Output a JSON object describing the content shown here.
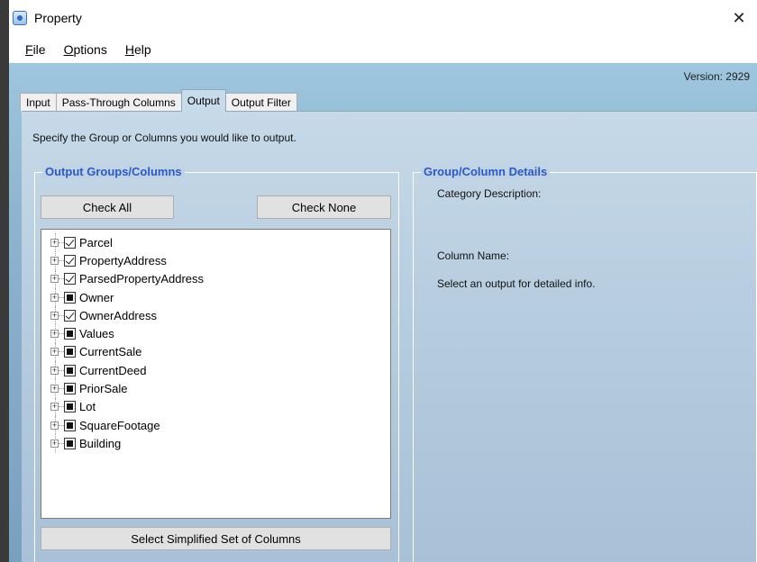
{
  "window": {
    "title": "Property",
    "close_glyph": "✕"
  },
  "menu": [
    {
      "label": "File",
      "accel": "F",
      "rest": "ile"
    },
    {
      "label": "Options",
      "accel": "O",
      "rest": "ptions"
    },
    {
      "label": "Help",
      "accel": "H",
      "rest": "elp"
    }
  ],
  "version": "Version: 2929",
  "tabs": [
    "Input",
    "Pass-Through Columns",
    "Output",
    "Output Filter"
  ],
  "active_tab": "Output",
  "instruction": "Specify the Group or Columns you would like to output.",
  "output_groups": {
    "title": "Output Groups/Columns",
    "check_all": "Check All",
    "check_none": "Check None",
    "items": [
      {
        "label": "Parcel",
        "state": "checked"
      },
      {
        "label": "PropertyAddress",
        "state": "checked"
      },
      {
        "label": "ParsedPropertyAddress",
        "state": "checked"
      },
      {
        "label": "Owner",
        "state": "partial"
      },
      {
        "label": "OwnerAddress",
        "state": "checked"
      },
      {
        "label": "Values",
        "state": "partial"
      },
      {
        "label": "CurrentSale",
        "state": "partial"
      },
      {
        "label": "CurrentDeed",
        "state": "partial"
      },
      {
        "label": "PriorSale",
        "state": "partial"
      },
      {
        "label": "Lot",
        "state": "partial"
      },
      {
        "label": "SquareFootage",
        "state": "partial"
      },
      {
        "label": "Building",
        "state": "partial"
      }
    ],
    "simplified_button": "Select Simplified Set of Columns"
  },
  "details": {
    "title": "Group/Column Details",
    "category_description": "Category Description:",
    "column_name": "Column Name:",
    "hint": "Select an output for detailed info."
  },
  "colors": {
    "group_title": "#2b59c8",
    "background_gradient_top": "#9ec6de",
    "background_gradient_bottom": "#7aa0c0"
  }
}
